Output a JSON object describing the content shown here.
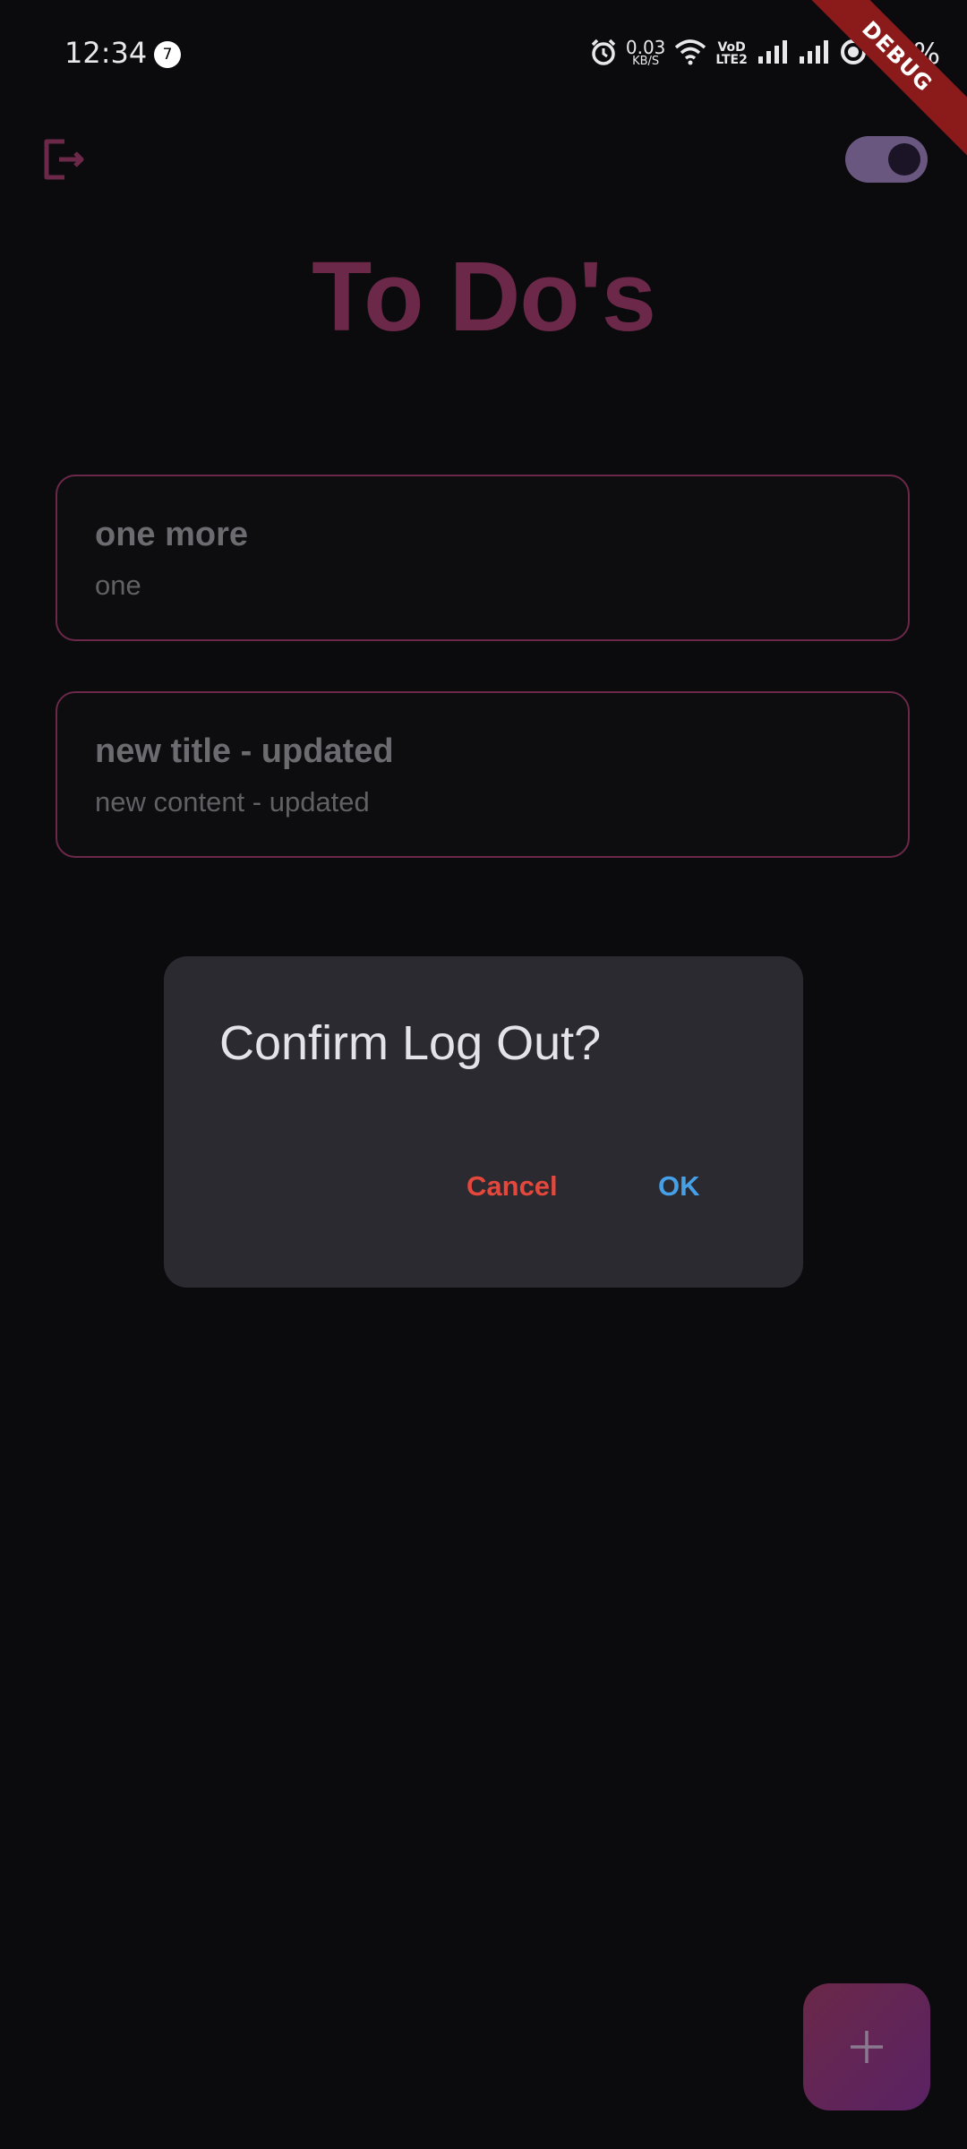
{
  "status_bar": {
    "time": "12:34",
    "notification_count": "7",
    "net_speed_value": "0.03",
    "net_speed_unit": "KB/S",
    "volte_label_top": "VoD",
    "volte_label_bottom": "LTE2",
    "battery": "79%",
    "debug_label": "DEBUG"
  },
  "app_bar": {
    "logout_icon": "logout-icon",
    "theme_toggle_on": true
  },
  "page": {
    "title": "To Do's"
  },
  "todos": [
    {
      "title": "one more",
      "content": "one"
    },
    {
      "title": "new title - updated",
      "content": "new content - updated"
    }
  ],
  "dialog": {
    "title": "Confirm Log Out?",
    "cancel_label": "Cancel",
    "ok_label": "OK"
  },
  "fab": {
    "icon": "plus-icon"
  },
  "colors": {
    "background": "#0b0b0e",
    "accent": "#6b2848",
    "dialog_bg": "#2b2a30",
    "cancel": "#e4473c",
    "ok": "#46a0e8"
  }
}
